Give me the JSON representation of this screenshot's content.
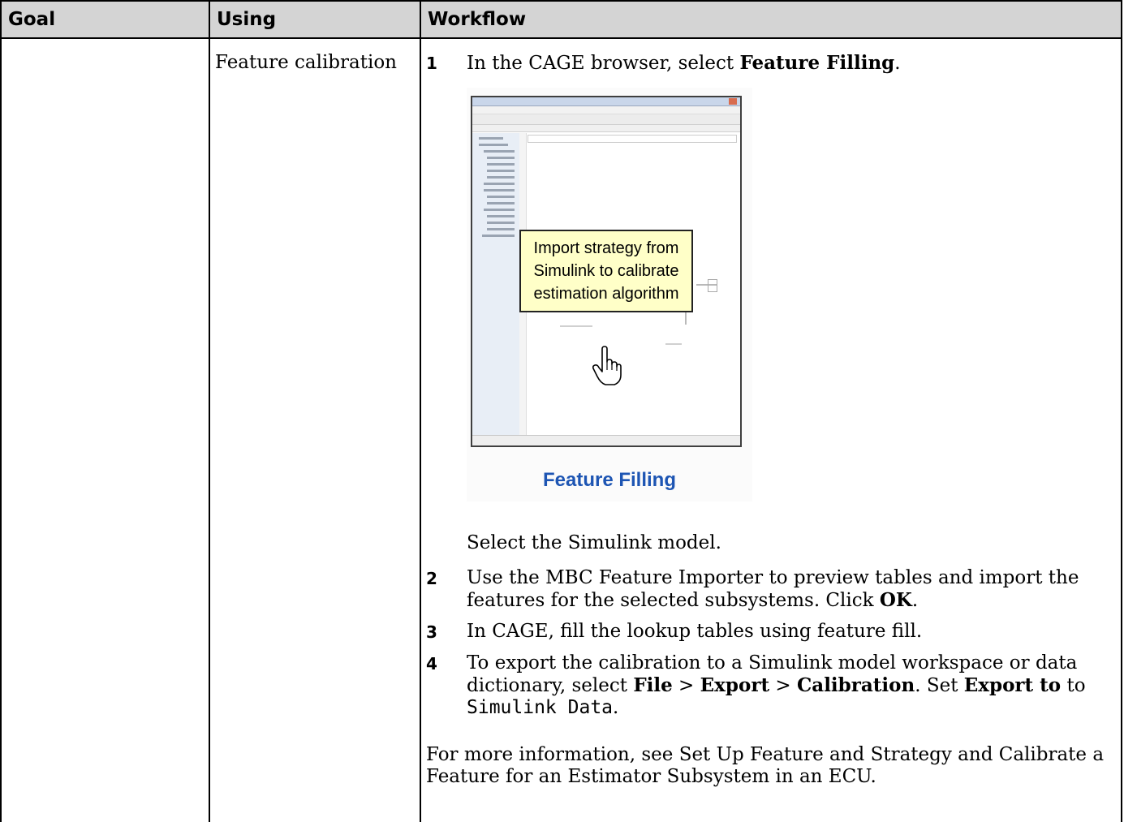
{
  "table": {
    "headers": {
      "goal": "Goal",
      "using": "Using",
      "workflow": "Workflow"
    },
    "goal_cell": "",
    "using_cell": "Feature calibration"
  },
  "steps": [
    {
      "num": "1",
      "text_before": "In the CAGE browser, select ",
      "bold": "Feature Filling",
      "text_after": "."
    },
    {
      "num": "2",
      "text_before": "Use the MBC Feature Importer to preview tables and import the features for the selected subsystems. Click ",
      "bold": "OK",
      "text_after": "."
    },
    {
      "num": "3",
      "text": "In CAGE, fill the lookup tables using feature fill."
    },
    {
      "num": "4",
      "text_1": "To export the calibration to a Simulink model workspace or data dictionary, select ",
      "bold_1": "File",
      "sep_1": " > ",
      "bold_2": "Export",
      "sep_2": " > ",
      "bold_3": "Calibration",
      "text_2": ". Set ",
      "bold_4": "Export to",
      "text_3": " to ",
      "code": "Simulink Data",
      "text_4": "."
    }
  ],
  "thumbnail": {
    "callout": "Import strategy from Simulink to calibrate estimation algorithm",
    "caption": "Feature Filling",
    "icon": "hand-pointer-icon",
    "caption_color": "#1d55b3",
    "callout_color": "#ffffc8"
  },
  "after_step1": "Select the Simulink model.",
  "more_info": "For more information, see Set Up Feature and Strategy and Calibrate a Feature for an Estimator Subsystem in an ECU.",
  "colors": {
    "header_bg": "#d4d4d4",
    "border": "#000000"
  }
}
